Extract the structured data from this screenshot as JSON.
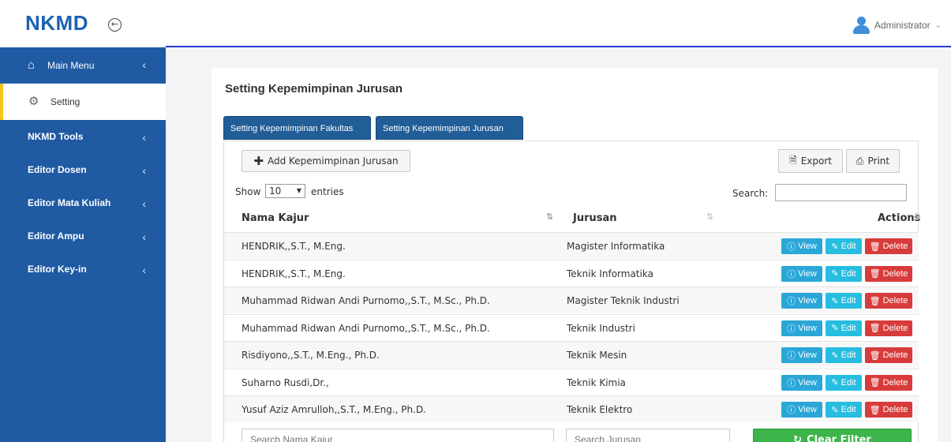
{
  "brand": {
    "name": "NKMD"
  },
  "user": {
    "name": "Administrator"
  },
  "sidebar": {
    "items": [
      {
        "label": "Main Menu"
      },
      {
        "label": "Setting"
      },
      {
        "label": "NKMD Tools"
      },
      {
        "label": "Editor Dosen"
      },
      {
        "label": "Editor Mata Kuliah"
      },
      {
        "label": "Editor Ampu"
      },
      {
        "label": "Editor Key-in"
      }
    ]
  },
  "page": {
    "title": "Setting Kepemimpinan Jurusan",
    "tabs": [
      {
        "label": "Setting Kepemimpinan Fakultas"
      },
      {
        "label": "Setting Kepemimpinan Jurusan"
      }
    ]
  },
  "toolbar": {
    "add_label": "Add Kepemimpinan Jurusan",
    "export_label": "Export",
    "print_label": "Print"
  },
  "table_controls": {
    "show_label": "Show",
    "show_value": "10",
    "entries_label": "entries",
    "search_label": "Search:"
  },
  "table": {
    "headers": {
      "name": "Nama Kajur",
      "jurusan": "Jurusan",
      "actions": "Actions"
    },
    "actions": {
      "view": "View",
      "edit": "Edit",
      "delete": "Delete"
    },
    "rows": [
      {
        "name": "HENDRIK,,S.T., M.Eng.",
        "jurusan": "Magister Informatika"
      },
      {
        "name": "HENDRIK,,S.T., M.Eng.",
        "jurusan": "Teknik Informatika"
      },
      {
        "name": "Muhammad Ridwan Andi Purnomo,,S.T., M.Sc., Ph.D.",
        "jurusan": "Magister Teknik Industri"
      },
      {
        "name": "Muhammad Ridwan Andi Purnomo,,S.T., M.Sc., Ph.D.",
        "jurusan": "Teknik Industri"
      },
      {
        "name": "Risdiyono,,S.T., M.Eng., Ph.D.",
        "jurusan": "Teknik Mesin"
      },
      {
        "name": "Suharno Rusdi,Dr.,",
        "jurusan": "Teknik Kimia"
      },
      {
        "name": "Yusuf Aziz Amrulloh,,S.T., M.Eng., Ph.D.",
        "jurusan": "Teknik Elektro"
      }
    ]
  },
  "filters": {
    "name_placeholder": "Search Nama Kajur",
    "jurusan_placeholder": "Search Jurusan",
    "clear_label": "Clear Filter"
  },
  "colors": {
    "sidebar": "#1f5aa3",
    "brand": "#1c63b4",
    "tab": "#215d96",
    "view": "#2aa7d8",
    "edit": "#27bde0",
    "delete": "#d83b3b",
    "clear": "#3cb54a"
  }
}
